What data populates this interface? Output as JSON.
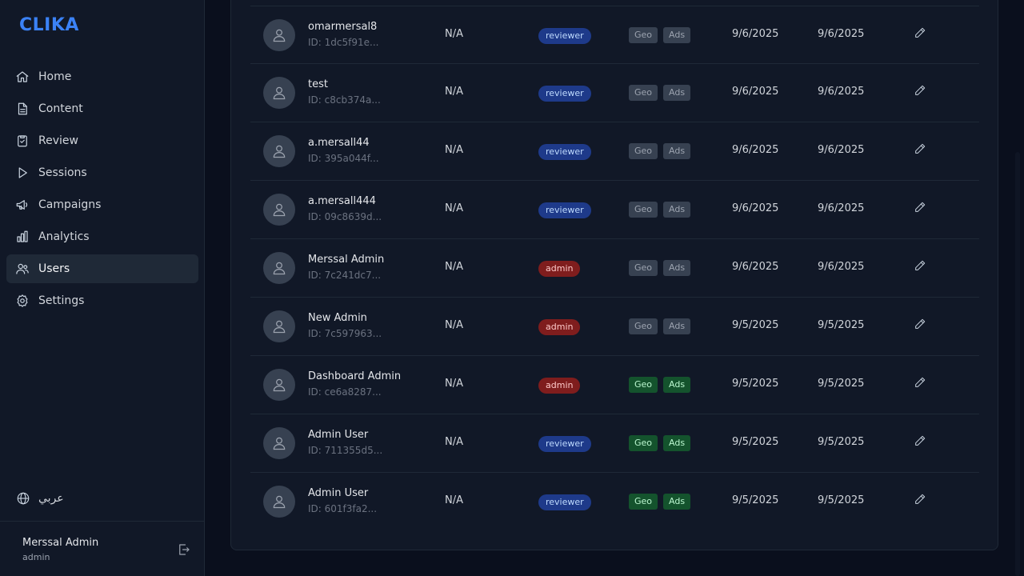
{
  "app": {
    "logo": "CLIKA"
  },
  "sidebar": {
    "items": [
      {
        "label": "Home",
        "icon": "home-icon"
      },
      {
        "label": "Content",
        "icon": "document-icon"
      },
      {
        "label": "Review",
        "icon": "clipboard-check-icon"
      },
      {
        "label": "Sessions",
        "icon": "play-icon"
      },
      {
        "label": "Campaigns",
        "icon": "megaphone-icon"
      },
      {
        "label": "Analytics",
        "icon": "bar-chart-icon"
      },
      {
        "label": "Users",
        "icon": "users-icon",
        "active": true
      },
      {
        "label": "Settings",
        "icon": "gear-icon"
      }
    ],
    "language_label": "عربي",
    "current_user": {
      "name": "Merssal Admin",
      "role": "admin"
    }
  },
  "users": [
    {
      "name": "omarmersal8",
      "id": "ID: 1dc5f91e...",
      "phone": "N/A",
      "role": "reviewer",
      "geo": "Geo",
      "ads": "Ads",
      "perms_on": false,
      "created": "9/6/2025",
      "updated": "9/6/2025"
    },
    {
      "name": "test",
      "id": "ID: c8cb374a...",
      "phone": "N/A",
      "role": "reviewer",
      "geo": "Geo",
      "ads": "Ads",
      "perms_on": false,
      "created": "9/6/2025",
      "updated": "9/6/2025"
    },
    {
      "name": "a.mersall44",
      "id": "ID: 395a044f...",
      "phone": "N/A",
      "role": "reviewer",
      "geo": "Geo",
      "ads": "Ads",
      "perms_on": false,
      "created": "9/6/2025",
      "updated": "9/6/2025"
    },
    {
      "name": "a.mersall444",
      "id": "ID: 09c8639d...",
      "phone": "N/A",
      "role": "reviewer",
      "geo": "Geo",
      "ads": "Ads",
      "perms_on": false,
      "created": "9/6/2025",
      "updated": "9/6/2025"
    },
    {
      "name": "Merssal Admin",
      "id": "ID: 7c241dc7...",
      "phone": "N/A",
      "role": "admin",
      "geo": "Geo",
      "ads": "Ads",
      "perms_on": false,
      "created": "9/6/2025",
      "updated": "9/6/2025"
    },
    {
      "name": "New Admin",
      "id": "ID: 7c597963...",
      "phone": "N/A",
      "role": "admin",
      "geo": "Geo",
      "ads": "Ads",
      "perms_on": false,
      "created": "9/5/2025",
      "updated": "9/5/2025"
    },
    {
      "name": "Dashboard Admin",
      "id": "ID: ce6a8287...",
      "phone": "N/A",
      "role": "admin",
      "geo": "Geo",
      "ads": "Ads",
      "perms_on": true,
      "created": "9/5/2025",
      "updated": "9/5/2025"
    },
    {
      "name": "Admin User",
      "id": "ID: 711355d5...",
      "phone": "N/A",
      "role": "reviewer",
      "geo": "Geo",
      "ads": "Ads",
      "perms_on": true,
      "created": "9/5/2025",
      "updated": "9/5/2025"
    },
    {
      "name": "Admin User",
      "id": "ID: 601f3fa2...",
      "phone": "N/A",
      "role": "reviewer",
      "geo": "Geo",
      "ads": "Ads",
      "perms_on": true,
      "created": "9/5/2025",
      "updated": "9/5/2025"
    }
  ]
}
